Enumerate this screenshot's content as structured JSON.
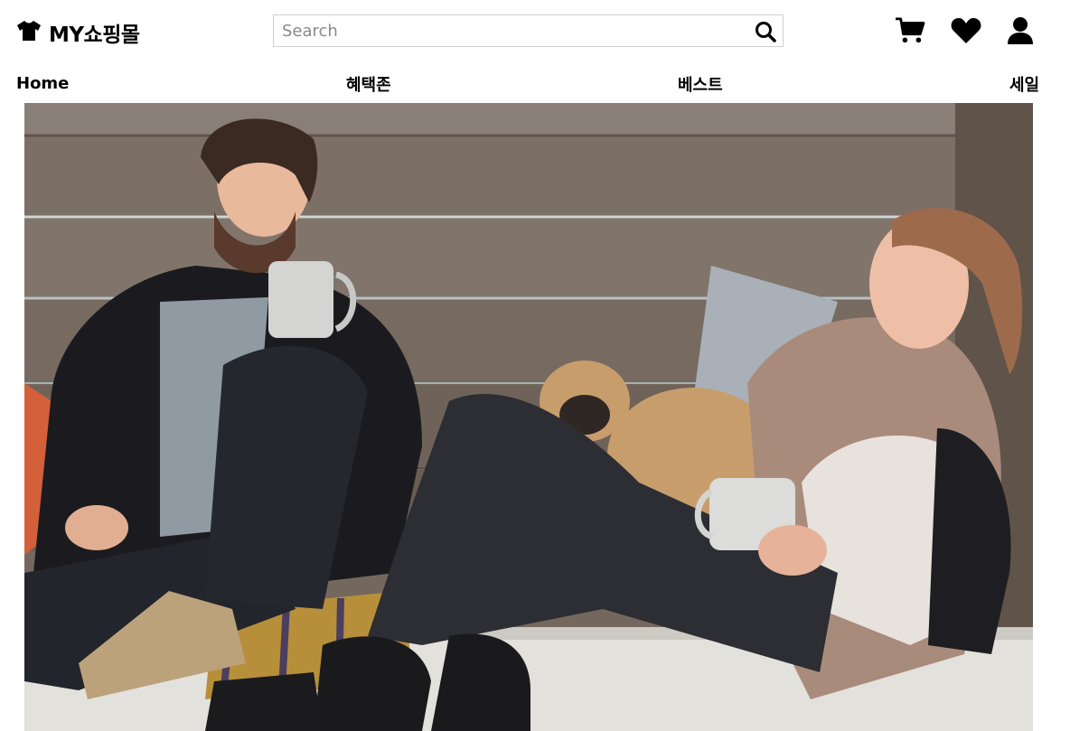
{
  "header": {
    "logo_icon": "tshirt-icon",
    "brand": "MY쇼핑몰",
    "search": {
      "placeholder": "Search",
      "value": "",
      "icon": "search-icon"
    },
    "actions": [
      "cart-icon",
      "heart-icon",
      "user-icon"
    ]
  },
  "nav": {
    "items": [
      {
        "label": "Home"
      },
      {
        "label": "혜택존"
      },
      {
        "label": "베스트"
      },
      {
        "label": "세일"
      }
    ]
  },
  "hero": {
    "image": "photo of a smiling man and woman holding mugs on a bench with a pug",
    "next_label": "›"
  }
}
